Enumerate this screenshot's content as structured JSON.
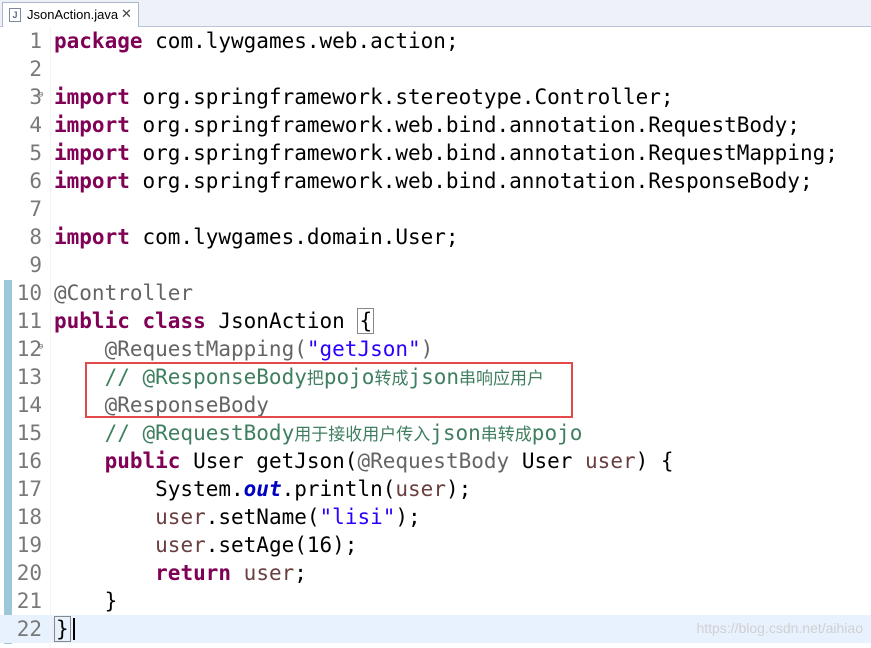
{
  "tab": {
    "file_icon": "J",
    "label": "JsonAction.java",
    "close": "✕"
  },
  "lines": {
    "l1": "package",
    "l1b": " com.lywgames.web.action;",
    "l3": "import",
    "l3b": " org.springframework.stereotype.Controller;",
    "l4": "import",
    "l4b": " org.springframework.web.bind.annotation.RequestBody;",
    "l5": "import",
    "l5b": " org.springframework.web.bind.annotation.RequestMapping;",
    "l6": "import",
    "l6b": " org.springframework.web.bind.annotation.ResponseBody;",
    "l8": "import",
    "l8b": " com.lywgames.domain.User;",
    "l10": "@Controller",
    "l11a": "public",
    "l11b": " ",
    "l11c": "class",
    "l11d": " JsonAction ",
    "l11e": "{",
    "l12a": "    @RequestMapping(",
    "l12b": "\"getJson\"",
    "l12c": ")",
    "l13a": "    // @ResponseBody",
    "l13b": "把",
    "l13c": "pojo",
    "l13d": "转成",
    "l13e": "json",
    "l13f": "串响应用户",
    "l14": "    @ResponseBody",
    "l15a": "    // @RequestBody",
    "l15b": "用于接收用户传入",
    "l15c": "json",
    "l15d": "串转成",
    "l15e": "pojo",
    "l16a": "    ",
    "l16b": "public",
    "l16c": " User getJson(",
    "l16d": "@RequestBody",
    "l16e": " User ",
    "l16f": "user",
    "l16g": ") {",
    "l17a": "        System.",
    "l17b": "out",
    "l17c": ".println(",
    "l17d": "user",
    "l17e": ");",
    "l18a": "        ",
    "l18b": "user",
    "l18c": ".setName(",
    "l18d": "\"lisi\"",
    "l18e": ");",
    "l19a": "        ",
    "l19b": "user",
    "l19c": ".setAge(16);",
    "l20a": "        ",
    "l20b": "return",
    "l20c": " ",
    "l20d": "user",
    "l20e": ";",
    "l21": "    }",
    "l22": "}"
  },
  "watermark": "https://blog.csdn.net/aihiao",
  "colors": {
    "keyword": "#7f0055",
    "annotation": "#646464",
    "string": "#2a00ff",
    "comment": "#3f7f5f",
    "field": "#0000c0",
    "highlight_box": "#e24a4a"
  }
}
